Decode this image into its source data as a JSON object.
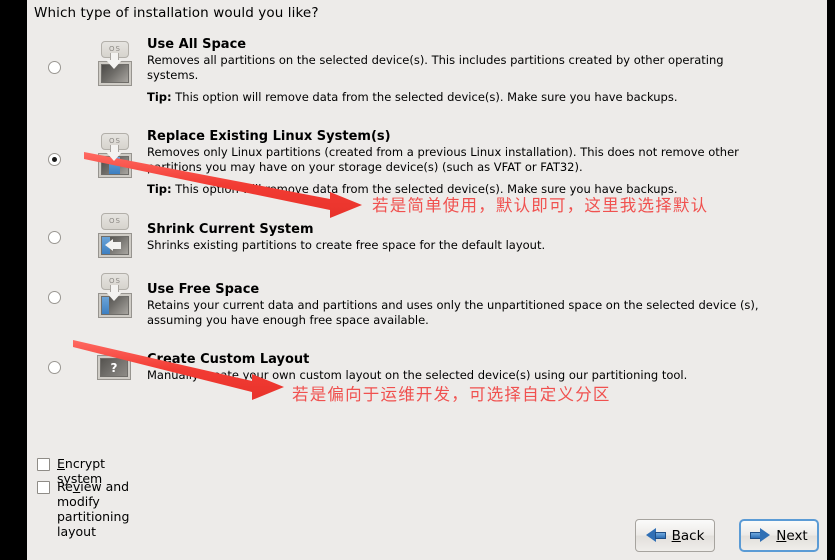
{
  "dialog": {
    "question": "Which type of installation would you like?"
  },
  "options": [
    {
      "id": "use-all-space",
      "title": "Use All Space",
      "desc": "Removes all partitions on the selected device(s).  This includes partitions created by other operating systems.",
      "tip_label": "Tip:",
      "tip_text": " This option will remove data from the selected device(s).  Make sure you have backups.",
      "icon": "disk-install-icon",
      "os_chip": "OS",
      "selected": false
    },
    {
      "id": "replace-existing-linux",
      "title": "Replace Existing Linux System(s)",
      "desc": "Removes only Linux partitions (created from a previous Linux installation).  This does not remove other partitions you may have on your storage device(s) (such as VFAT or FAT32).",
      "tip_label": "Tip:",
      "tip_text": " This option will remove data from the selected device(s).  Make sure you have backups.",
      "icon": "disk-replace-icon",
      "os_chip": "OS",
      "selected": true
    },
    {
      "id": "shrink-current-system",
      "title": "Shrink Current System",
      "desc": "Shrinks existing partitions to create free space for the default layout.",
      "tip_label": "",
      "tip_text": "",
      "icon": "disk-shrink-icon",
      "os_chip": "OS",
      "selected": false
    },
    {
      "id": "use-free-space",
      "title": "Use Free Space",
      "desc": "Retains your current data and partitions and uses only the unpartitioned space on the selected device (s), assuming you have enough free space available.",
      "tip_label": "",
      "tip_text": "",
      "icon": "disk-freespace-icon",
      "os_chip": "OS",
      "selected": false
    },
    {
      "id": "create-custom-layout",
      "title": "Create Custom Layout",
      "desc": "Manually create your own custom layout on the selected device(s) using our partitioning tool.",
      "tip_label": "",
      "tip_text": "",
      "icon": "question-mark-icon",
      "os_chip": "?",
      "selected": false
    }
  ],
  "checkboxes": [
    {
      "id": "encrypt-system",
      "mnemonic": "E",
      "rest": "ncrypt system",
      "checked": false
    },
    {
      "id": "review-modify-partitioning",
      "pre": "Re",
      "mnemonic": "v",
      "rest": "iew and modify partitioning layout",
      "checked": false
    }
  ],
  "buttons": {
    "back": {
      "pre": "",
      "mnemonic": "B",
      "rest": "ack",
      "icon": "arrow-left-icon"
    },
    "next": {
      "pre": "",
      "mnemonic": "N",
      "rest": "ext",
      "icon": "arrow-right-icon",
      "focused": true
    }
  },
  "annotations": [
    {
      "id": "annotation-default-choice",
      "text": "若是简单使用，默认即可，这里我选择默认",
      "color": "#f0514f"
    },
    {
      "id": "annotation-custom-partition",
      "text": "若是偏向于运维开发，可选择自定义分区",
      "color": "#f0514f"
    }
  ],
  "colors": {
    "background": "#edebe9",
    "window_edge": "#000000",
    "annotation_red": "#f0514f",
    "accent_blue": "#3d7fc1"
  }
}
